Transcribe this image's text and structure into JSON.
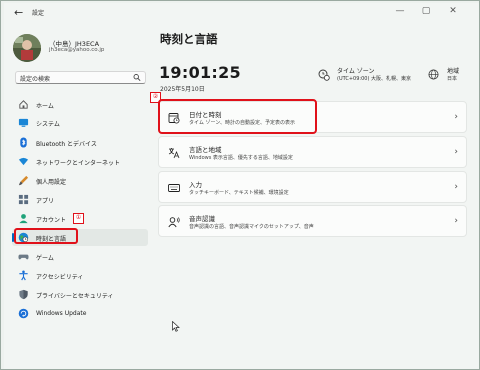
{
  "window": {
    "title": "設定",
    "back_glyph": "←",
    "controls": {
      "minimize": "—",
      "maximize": "▢",
      "close": "✕"
    }
  },
  "profile": {
    "name": "（中島）JH3ECA",
    "email": "jh3eca@yahoo.co.jp"
  },
  "search": {
    "placeholder": "設定の検索",
    "icon": "search-icon"
  },
  "sidebar": {
    "items": [
      {
        "label": "ホーム",
        "icon": "home-icon"
      },
      {
        "label": "システム",
        "icon": "system-icon"
      },
      {
        "label": "Bluetooth とデバイス",
        "icon": "bluetooth-icon"
      },
      {
        "label": "ネットワークとインターネット",
        "icon": "network-icon"
      },
      {
        "label": "個人用設定",
        "icon": "brush-icon"
      },
      {
        "label": "アプリ",
        "icon": "apps-icon"
      },
      {
        "label": "アカウント",
        "icon": "account-icon"
      },
      {
        "label": "時刻と言語",
        "icon": "globe-clock-icon",
        "selected": true
      },
      {
        "label": "ゲーム",
        "icon": "gamepad-icon"
      },
      {
        "label": "アクセシビリティ",
        "icon": "accessibility-icon"
      },
      {
        "label": "プライバシーとセキュリティ",
        "icon": "shield-icon"
      },
      {
        "label": "Windows Update",
        "icon": "update-icon"
      }
    ]
  },
  "annotations": {
    "step1": "①",
    "step2": "②"
  },
  "main": {
    "title": "時刻と言語",
    "time": "19:01:25",
    "date": "2025年5月10日",
    "timezone": {
      "title": "タイム ゾーン",
      "value": "(UTC+09:00) 大阪、札幌、東京"
    },
    "region": {
      "title": "地域",
      "value": "日本"
    },
    "cards": [
      {
        "title": "日付と時刻",
        "subtitle": "タイム ゾーン、時計の自動設定、予定表の表示",
        "icon": "calendar-clock-icon"
      },
      {
        "title": "言語と地域",
        "subtitle": "Windows 表示言語、優先する言語、地域設定",
        "icon": "language-icon"
      },
      {
        "title": "入力",
        "subtitle": "タッチキーボード、テキスト候補、環境設定",
        "icon": "keyboard-icon"
      },
      {
        "title": "音声認識",
        "subtitle": "音声認識の言語、音声認識マイクのセットアップ、音声",
        "icon": "speech-icon"
      }
    ],
    "chevron": "›"
  },
  "colors": {
    "accent": "#0067c0",
    "highlight": "#e0111a",
    "background": "#f2f5f3",
    "card": "#fbfcfb"
  }
}
